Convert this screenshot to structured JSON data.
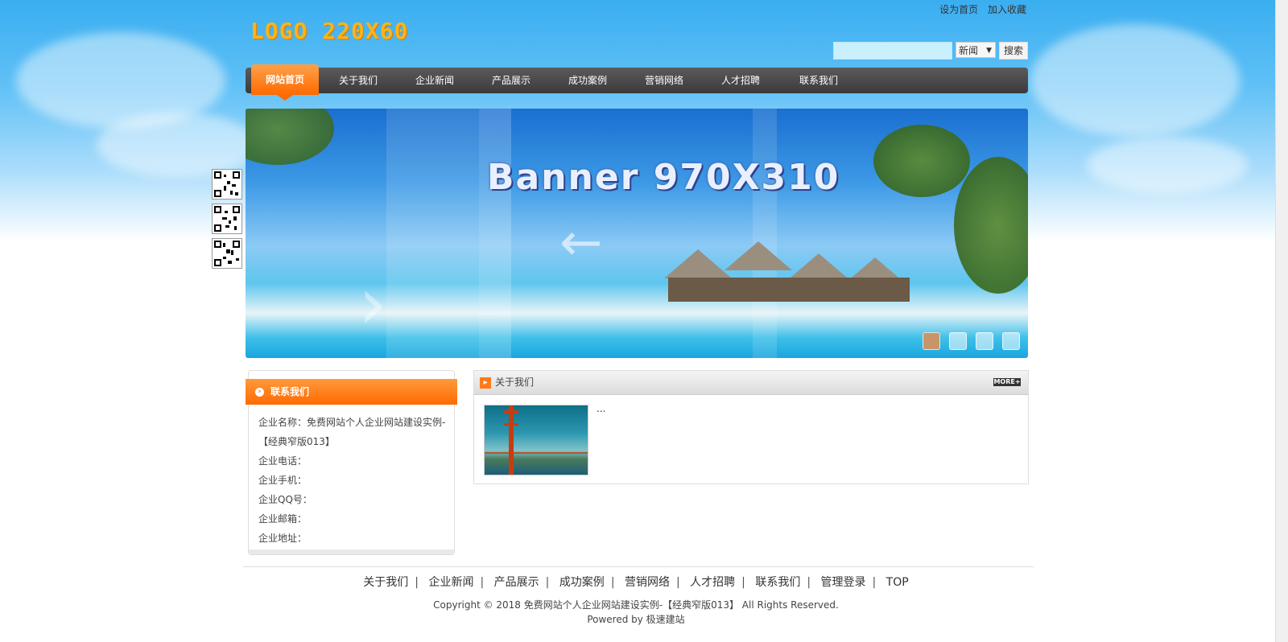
{
  "header": {
    "logo_text": "LOGO 220X60",
    "set_home": "设为首页",
    "add_favorite": "加入收藏"
  },
  "search": {
    "placeholder": "",
    "category_selected": "新闻",
    "button_label": "搜索"
  },
  "nav": {
    "items": [
      {
        "label": "网站首页",
        "active": true
      },
      {
        "label": "关于我们"
      },
      {
        "label": "企业新闻"
      },
      {
        "label": "产品展示"
      },
      {
        "label": "成功案例"
      },
      {
        "label": "营销网络"
      },
      {
        "label": "人才招聘"
      },
      {
        "label": "联系我们"
      }
    ]
  },
  "banner": {
    "title": "Banner 970X310",
    "slide_count": 4,
    "active_slide": 1
  },
  "contact": {
    "title": "联系我们",
    "lines": [
      "企业名称：免费网站个人企业网站建设实例-【经典窄版013】",
      "企业电话：",
      "企业手机：",
      "企业QQ号：",
      "企业邮箱：",
      "企业地址："
    ]
  },
  "about": {
    "title": "关于我们",
    "more_label": "MORE+",
    "summary": "..."
  },
  "footer": {
    "links": [
      "关于我们",
      "企业新闻",
      "产品展示",
      "成功案例",
      "营销网络",
      "人才招聘",
      "联系我们",
      "管理登录",
      "TOP"
    ],
    "copyright": "Copyright © 2018 免费网站个人企业网站建设实例-【经典窄版013】 All Rights Reserved.",
    "powered": "Powered by 极速建站"
  },
  "colors": {
    "accent_orange": "#ff6a00",
    "nav_dark": "#3a3a3a",
    "sky_blue": "#3aaef0"
  }
}
